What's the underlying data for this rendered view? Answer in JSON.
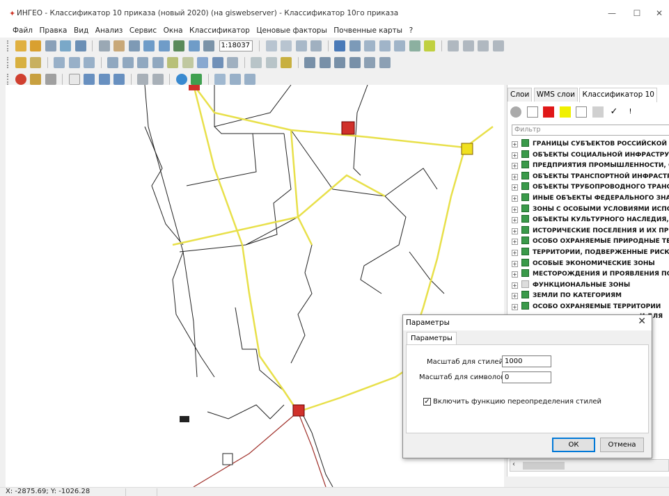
{
  "window": {
    "title": "ИНГЕО - Классификатор 10 приказа (новый 2020) (на giswebserver) - Классификатор 10го приказа",
    "icon": "ingeo-app-icon",
    "minimize": "—",
    "maximize": "☐",
    "close": "✕"
  },
  "menu": {
    "items": [
      "Файл",
      "Правка",
      "Вид",
      "Анализ",
      "Сервис",
      "Окна",
      "Классификатор",
      "Ценовые факторы",
      "Почвенные карты",
      "?"
    ]
  },
  "toolbar": {
    "scale_value": "1:18037"
  },
  "panel": {
    "tabs": [
      "Слои",
      "WMS слои",
      "Классификатор 10"
    ],
    "active_tab": 2,
    "filter_placeholder": "Фильтр",
    "tree": [
      {
        "label": "ГРАНИЦЫ СУБЪЕКТОВ РОССИЙСКОЙ ФЕ",
        "enabled": true
      },
      {
        "label": "ОБЪЕКТЫ СОЦИАЛЬНОЙ ИНФРАСТРУКТ",
        "enabled": true
      },
      {
        "label": "ПРЕДПРИЯТИЯ ПРОМЫШЛЕННОСТИ, СЕ",
        "enabled": true
      },
      {
        "label": "ОБЪЕКТЫ ТРАНСПОРТНОЙ ИНФРАСТРУ",
        "enabled": true
      },
      {
        "label": "ОБЪЕКТЫ ТРУБОПРОВОДНОГО ТРАНСП",
        "enabled": true
      },
      {
        "label": "ИНЫЕ ОБЪЕКТЫ ФЕДЕРАЛЬНОГО ЗНАЧЕ",
        "enabled": true
      },
      {
        "label": "ЗОНЫ С ОСОБЫМИ УСЛОВИЯМИ ИСПОЛ",
        "enabled": true
      },
      {
        "label": "ОБЪЕКТЫ КУЛЬТУРНОГО НАСЛЕДИЯ, П",
        "enabled": true
      },
      {
        "label": "ИСТОРИЧЕСКИЕ ПОСЕЛЕНИЯ И ИХ ПРЕД",
        "enabled": true
      },
      {
        "label": "ОСОБО ОХРАНЯЕМЫЕ ПРИРОДНЫЕ ТЕР",
        "enabled": true
      },
      {
        "label": "ТЕРРИТОРИИ, ПОДВЕРЖЕННЫЕ РИСКУ",
        "enabled": true
      },
      {
        "label": "ОСОБЫЕ ЭКОНОМИЧЕСКИЕ ЗОНЫ",
        "enabled": true
      },
      {
        "label": "МЕСТОРОЖДЕНИЯ И ПРОЯВЛЕНИЯ ПОЛ",
        "enabled": true
      },
      {
        "label": "ФУНКЦИОНАЛЬНЫЕ ЗОНЫ",
        "enabled": false
      },
      {
        "label": "ЗЕМЛИ ПО КАТЕГОРИЯМ",
        "enabled": true
      },
      {
        "label": "ОСОБО ОХРАНЯЕМЫЕ ТЕРРИТОРИИ",
        "enabled": true
      },
      {
        "label": "И ДЛЯ",
        "enabled": true
      }
    ]
  },
  "dialog": {
    "title": "Параметры",
    "tab": "Параметры",
    "style_scale_label": "Масштаб для стилей 1:",
    "style_scale_value": "1000",
    "symbol_scale_label": "Масштаб для символов 1:",
    "symbol_scale_value": "0",
    "override_label": "Включить функцию переопределения стилей",
    "override_checked": true,
    "ok_label": "ОК",
    "cancel_label": "Отмена"
  },
  "statusbar": {
    "coords": "X: -2875.69; Y: -1026.28"
  },
  "colors": {
    "road": "#e8e04a",
    "rail": "#a0302a",
    "accent": "#0078d7"
  }
}
